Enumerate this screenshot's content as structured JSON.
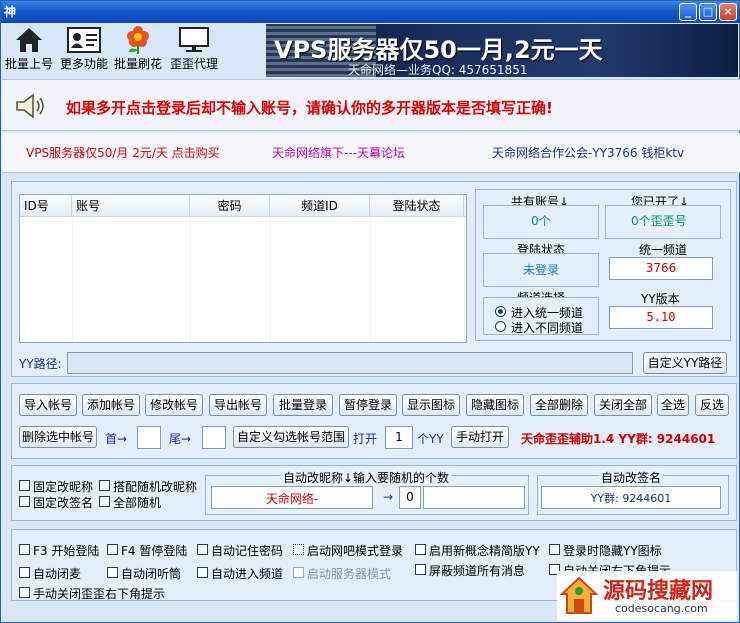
{
  "window": {
    "title_icon": "神",
    "controls": [
      "_",
      "□",
      "×"
    ]
  },
  "toolbar": {
    "items": [
      {
        "label": "批量上号",
        "icon": "house-icon"
      },
      {
        "label": "更多功能",
        "icon": "id-card-icon"
      },
      {
        "label": "批量刷花",
        "icon": "flower-icon"
      },
      {
        "label": "歪歪代理",
        "icon": "monitor-icon"
      }
    ]
  },
  "banner": {
    "headline": "VPS服务器仅50一月,2元一天",
    "sub": "天命网络—业务QQ: 457651851"
  },
  "notice": {
    "text": "如果多开点击登录后却不输入账号，请确认你的多开器版本是否填写正确!",
    "icon": "speaker-icon"
  },
  "links": {
    "vps": "VPS服务器仅50/月 2元/天 点击购买",
    "forum": "天命网络旗下---天幕论坛",
    "guild": "天命网络合作公会-YY3766 钱柜ktv"
  },
  "table": {
    "columns": [
      "ID号",
      "账号",
      "密码",
      "频道ID",
      "登陆状态"
    ]
  },
  "stats": {
    "total_label": "共有账号↓",
    "total_value": "0个",
    "opened_label": "您已开了↓",
    "opened_value": "0个歪歪号",
    "login_label": "登陆状态",
    "login_value": "未登录",
    "channel_label": "统一频道",
    "channel_value": "3766",
    "select_label": "频道选择",
    "opt_unified": "进入统一频道",
    "opt_diff": "进入不同频道",
    "version_label": "YY版本",
    "version_value": "5.10"
  },
  "yy_path": {
    "label": "YY路径:",
    "value": "",
    "button": "自定义YY路径"
  },
  "buttons_row1": [
    "导入帐号",
    "添加帐号",
    "修改帐号",
    "导出帐号",
    "批量登录",
    "暂停登录",
    "显示图标",
    "隐藏图标",
    "全部删除",
    "关闭全部",
    "全选",
    "反选"
  ],
  "row2": {
    "delete_selected": "删除选中帐号",
    "first_label": "首→",
    "first_value": "",
    "last_label": "尾→",
    "last_value": "",
    "custom_range": "自定义勾选帐号范围",
    "open_label": "打开",
    "open_value": "1",
    "open_unit": "个YY",
    "manual_open": "手动打开",
    "promo": "天命歪歪辅助1.4 YY群: 9244601"
  },
  "nickname": {
    "fixed_nick": "固定改昵称",
    "random_nick": "搭配随机改昵称",
    "fixed_sign": "固定改签名",
    "all_random": "全部随机",
    "auto_nick_label": "自动改昵称↓输入要随机的个数",
    "nick_value": "天命网络-",
    "arrow": "→",
    "count_value": "0",
    "auto_sign_label": "自动改签名",
    "sign_value": "YY群: 9244601"
  },
  "options": [
    "F3 开始登陆",
    "F4 暂停登陆",
    "自动记住密码",
    "启动网吧模式登录",
    "启用新概念精简版YY",
    "登录时隐藏YY图标",
    "自动闭麦",
    "自动闭听筒",
    "自动进入频道",
    "启动服务器模式",
    "屏蔽频道所有消息",
    "自动关闭右下角提示",
    "手动关闭歪歪右下角提示"
  ],
  "watermark": {
    "cn": "源码搜藏网",
    "en": "codesocang.com"
  },
  "colors": {
    "title_blue": "#1457cd",
    "alert_red": "#e00000",
    "link_red": "#d40000",
    "link_magenta": "#c000c0",
    "link_navy": "#1a2f8c",
    "stat_green": "#009a6a",
    "stat_blue": "#1a7ac8"
  }
}
